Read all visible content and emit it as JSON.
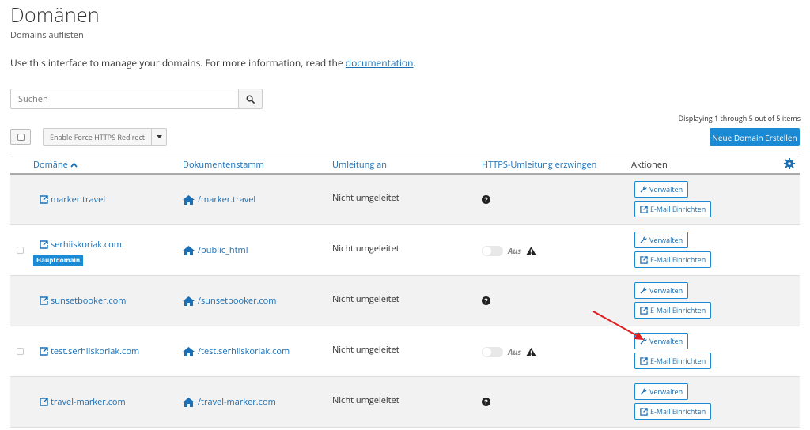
{
  "page": {
    "title": "Domänen",
    "subtitle": "Domains auflisten",
    "intro": "Use this interface to manage your domains. For more information, read the ",
    "intro_link": "documentation",
    "intro_end": "."
  },
  "search": {
    "placeholder": "Suchen"
  },
  "pagination": {
    "displaying": "Displaying 1 through 5 out of 5 items"
  },
  "toolbar": {
    "force_https_label": "Enable Force HTTPS Redirect",
    "new_domain_label": "Neue Domain Erstellen"
  },
  "table": {
    "headers": {
      "domain": "Domäne",
      "docroot": "Dokumentenstamm",
      "redirect": "Umleitung an",
      "https": "HTTPS-Umleitung erzwingen",
      "actions": "Aktionen"
    },
    "manage_label": "Verwalten",
    "email_label": "E-Mail Einrichten",
    "rows": [
      {
        "domain": "marker.travel",
        "docroot": "/marker.travel",
        "redirect": "Nicht umgeleitet",
        "https": "unknown"
      },
      {
        "domain": "serhiiskoriak.com",
        "docroot": "/public_html",
        "redirect": "Nicht umgeleitet",
        "https": "Aus",
        "badge": "Hauptdomain"
      },
      {
        "domain": "sunsetbooker.com",
        "docroot": "/sunsetbooker.com",
        "redirect": "Nicht umgeleitet",
        "https": "unknown"
      },
      {
        "domain": "test.serhiiskoriak.com",
        "docroot": "/test.serhiiskoriak.com",
        "redirect": "Nicht umgeleitet",
        "https": "Aus"
      },
      {
        "domain": "travel-marker.com",
        "docroot": "/travel-marker.com",
        "redirect": "Nicht umgeleitet",
        "https": "unknown"
      }
    ]
  },
  "colors": {
    "accent": "#1a8ad4",
    "link": "#1a6fb5",
    "annotation_arrow": "#e02020"
  }
}
